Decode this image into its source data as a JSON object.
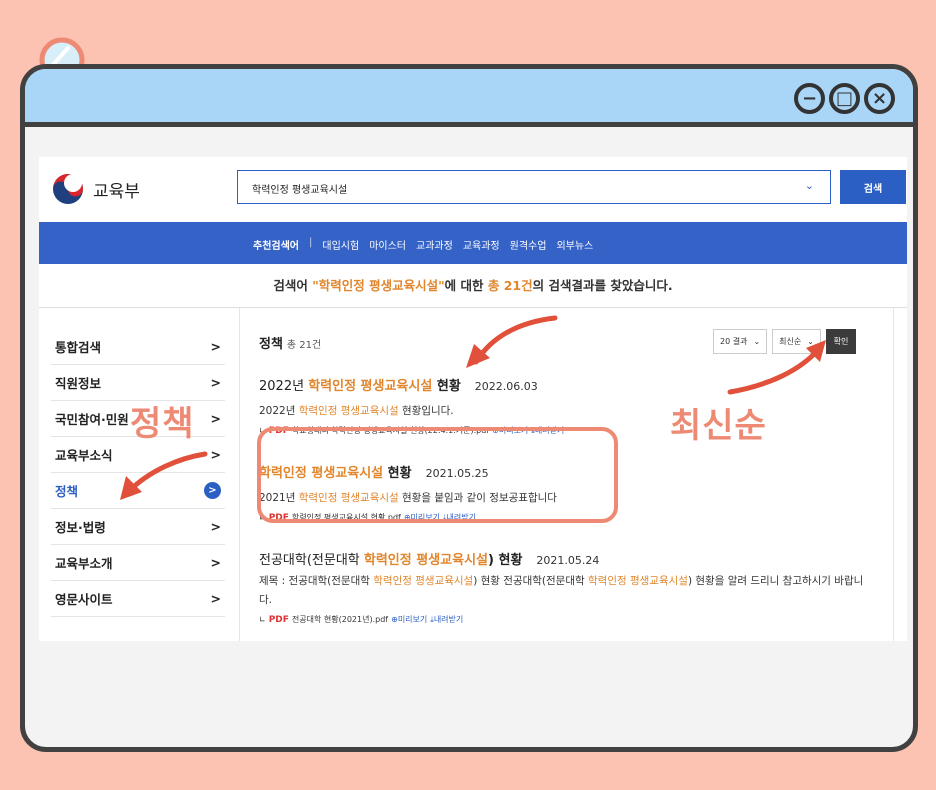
{
  "window": {
    "controls": [
      "minimize-icon",
      "maximize-icon",
      "close-icon"
    ]
  },
  "site": {
    "logo_text": "교육부"
  },
  "search": {
    "value": "학력인정 평생교육시설",
    "button": "검색"
  },
  "nav": {
    "label": "추천검색어",
    "sep": "|",
    "items": [
      "대입시험",
      "마이스터",
      "교과과정",
      "교육과정",
      "원격수업",
      "외부뉴스"
    ]
  },
  "result_msg": {
    "p1": "검색어 ",
    "q": "\"학력인정 평생교육시설\"",
    "p2": "에 대한 ",
    "count": "총 21건",
    "p3": "의 검색결과를 찾았습니다."
  },
  "sidebar": {
    "items": [
      {
        "label": "통합검색",
        "icon": ">"
      },
      {
        "label": "직원정보",
        "icon": ">"
      },
      {
        "label": "국민참여·민원",
        "icon": ">"
      },
      {
        "label": "교육부소식",
        "icon": ">"
      },
      {
        "label": "정책",
        "icon": ">"
      },
      {
        "label": "정보·법령",
        "icon": ">"
      },
      {
        "label": "교육부소개",
        "icon": ">"
      },
      {
        "label": "영문사이트",
        "icon": ">"
      }
    ]
  },
  "section": {
    "title": "정책",
    "count": "총 21건"
  },
  "controls": {
    "per_page": "20 결과",
    "sort": "최신순",
    "confirm": "확인"
  },
  "results": [
    {
      "pre": "2022년 ",
      "hl": "학력인정 평생교육시설",
      "post": " 현황",
      "date": "2022.06.03",
      "desc_pre": "2022년 ",
      "desc_hl": "학력인정 평생교육시설",
      "desc_post": " 현황입니다.",
      "file": "학교형태의 학력인정 평생교육시설 현황(22.4.1.기준).pdf"
    },
    {
      "pre": "",
      "hl": "학력인정 평생교육시설",
      "post": " 현황",
      "date": "2021.05.25",
      "desc_pre": "2021년 ",
      "desc_hl": "학력인정 평생교육시설",
      "desc_post": " 현황을 붙임과 같이 정보공표합니다",
      "file": "학력인정 평생교육시설 현황.pdf"
    },
    {
      "pre": "전공대학(전문대학 ",
      "hl": "학력인정 평생교육시설",
      "post": ") 현황",
      "date": "2021.05.24",
      "desc_a": "제목 : 전공대학(전문대학 ",
      "desc_hl1": "학력인정 평생교육시설",
      "desc_b": ") 현황 전공대학(전문대학 ",
      "desc_hl2": "학력인정 평생교육시설",
      "desc_c": ") 현황을 알려 드리니 참고하시기 바랍니다.",
      "file": "전공대학 현황(2021년).pdf"
    }
  ],
  "file_links": {
    "preview": "미리보기",
    "download": "내려받기",
    "pdf": "PDF"
  },
  "annotations": {
    "policy": "정책",
    "latest": "최신순"
  },
  "colors": {
    "background": "#fcc3b2",
    "titlebar": "#a9d5f7",
    "accent": "#2b5fc4",
    "highlight": "#e2862d",
    "annotation": "#ee8a74"
  }
}
